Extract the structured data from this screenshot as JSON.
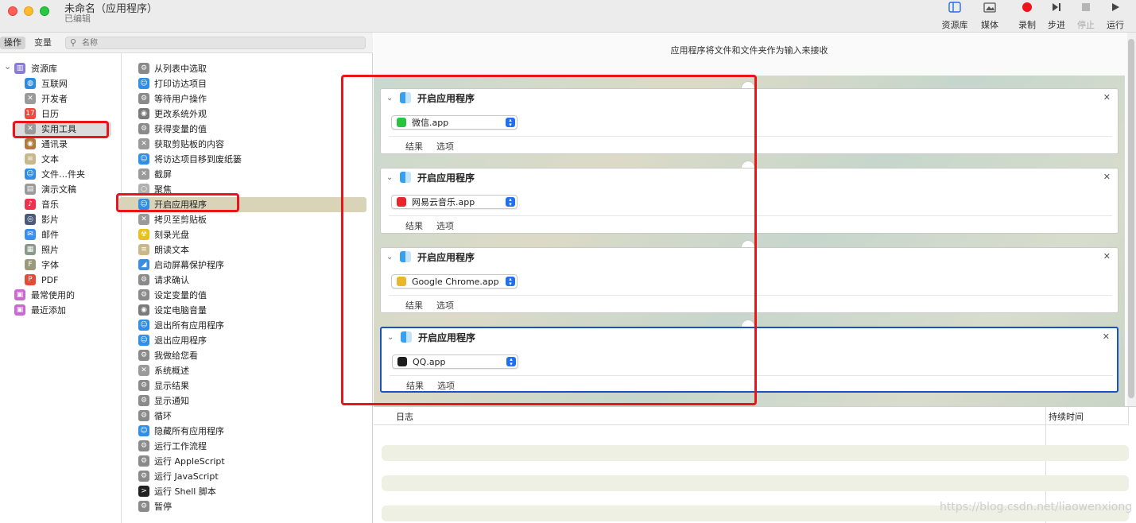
{
  "window": {
    "title": "未命名（应用程序）",
    "subtitle": "已编辑"
  },
  "toolbar": [
    {
      "label": "资源库",
      "icon": "library-icon"
    },
    {
      "label": "媒体",
      "icon": "media-icon"
    },
    {
      "label": "录制",
      "icon": "record-icon"
    },
    {
      "label": "步进",
      "icon": "step-icon"
    },
    {
      "label": "停止",
      "icon": "stop-icon"
    },
    {
      "label": "运行",
      "icon": "run-icon"
    }
  ],
  "library_header": {
    "actions_tab": "操作",
    "variables_tab": "变量",
    "search_placeholder": "名称"
  },
  "library": [
    {
      "label": "资源库",
      "icon": "library-icon"
    },
    {
      "label": "互联网",
      "icon": "globe-icon"
    },
    {
      "label": "开发者",
      "icon": "tools-icon"
    },
    {
      "label": "日历",
      "icon": "calendar-icon"
    },
    {
      "label": "实用工具",
      "icon": "tools-icon"
    },
    {
      "label": "通讯录",
      "icon": "contacts-icon"
    },
    {
      "label": "文本",
      "icon": "text-icon"
    },
    {
      "label": "文件…件夹",
      "icon": "finder-icon"
    },
    {
      "label": "演示文稿",
      "icon": "presentation-icon"
    },
    {
      "label": "音乐",
      "icon": "music-icon"
    },
    {
      "label": "影片",
      "icon": "movie-icon"
    },
    {
      "label": "邮件",
      "icon": "mail-icon"
    },
    {
      "label": "照片",
      "icon": "photos-icon"
    },
    {
      "label": "字体",
      "icon": "font-icon"
    },
    {
      "label": "PDF",
      "icon": "pdf-icon"
    },
    {
      "label": "最常使用的",
      "icon": "smart-folder-icon"
    },
    {
      "label": "最近添加",
      "icon": "smart-folder-icon"
    }
  ],
  "actions": [
    {
      "label": "从列表中选取",
      "icon": "automator-icon"
    },
    {
      "label": "打印访达项目",
      "icon": "finder-icon"
    },
    {
      "label": "等待用户操作",
      "icon": "automator-icon"
    },
    {
      "label": "更改系统外观",
      "icon": "settings-icon"
    },
    {
      "label": "获得变量的值",
      "icon": "automator-icon"
    },
    {
      "label": "获取剪贴板的内容",
      "icon": "tools-icon"
    },
    {
      "label": "将访达项目移到废纸篓",
      "icon": "finder-icon"
    },
    {
      "label": "截屏",
      "icon": "tools-icon"
    },
    {
      "label": "聚焦",
      "icon": "spotlight-icon"
    },
    {
      "label": "开启应用程序",
      "icon": "finder-icon"
    },
    {
      "label": "拷贝至剪贴板",
      "icon": "tools-icon"
    },
    {
      "label": "刻录光盘",
      "icon": "burn-icon"
    },
    {
      "label": "朗读文本",
      "icon": "text-icon"
    },
    {
      "label": "启动屏幕保护程序",
      "icon": "screensaver-icon"
    },
    {
      "label": "请求确认",
      "icon": "automator-icon"
    },
    {
      "label": "设定变量的值",
      "icon": "automator-icon"
    },
    {
      "label": "设定电脑音量",
      "icon": "settings-icon"
    },
    {
      "label": "退出所有应用程序",
      "icon": "finder-icon"
    },
    {
      "label": "退出应用程序",
      "icon": "finder-icon"
    },
    {
      "label": "我做给您看",
      "icon": "automator-icon"
    },
    {
      "label": "系统概述",
      "icon": "tools-icon"
    },
    {
      "label": "显示结果",
      "icon": "automator-icon"
    },
    {
      "label": "显示通知",
      "icon": "automator-icon"
    },
    {
      "label": "循环",
      "icon": "automator-icon"
    },
    {
      "label": "隐藏所有应用程序",
      "icon": "finder-icon"
    },
    {
      "label": "运行工作流程",
      "icon": "automator-icon"
    },
    {
      "label": "运行 AppleScript",
      "icon": "automator-icon"
    },
    {
      "label": "运行 JavaScript",
      "icon": "automator-icon"
    },
    {
      "label": "运行 Shell 脚本",
      "icon": "terminal-icon"
    },
    {
      "label": "暂停",
      "icon": "automator-icon"
    }
  ],
  "workflow": {
    "header": "应用程序将文件和文件夹作为输入来接收",
    "cards": [
      {
        "title": "开启应用程序",
        "app": "微信.app",
        "app_icon": "wechat-icon",
        "tab_results": "结果",
        "tab_options": "选项"
      },
      {
        "title": "开启应用程序",
        "app": "网易云音乐.app",
        "app_icon": "netease-music-icon",
        "tab_results": "结果",
        "tab_options": "选项"
      },
      {
        "title": "开启应用程序",
        "app": "Google Chrome.app",
        "app_icon": "chrome-icon",
        "tab_results": "结果",
        "tab_options": "选项"
      },
      {
        "title": "开启应用程序",
        "app": "QQ.app",
        "app_icon": "qq-icon",
        "tab_results": "结果",
        "tab_options": "选项"
      }
    ]
  },
  "log": {
    "col_log": "日志",
    "col_duration": "持续时间"
  },
  "watermark": "https://blog.csdn.net/liaowenxiong",
  "colors": {
    "selection": "#d9d4b8",
    "highlight_box": "#e8161b",
    "active_card_border": "#1852c7"
  }
}
